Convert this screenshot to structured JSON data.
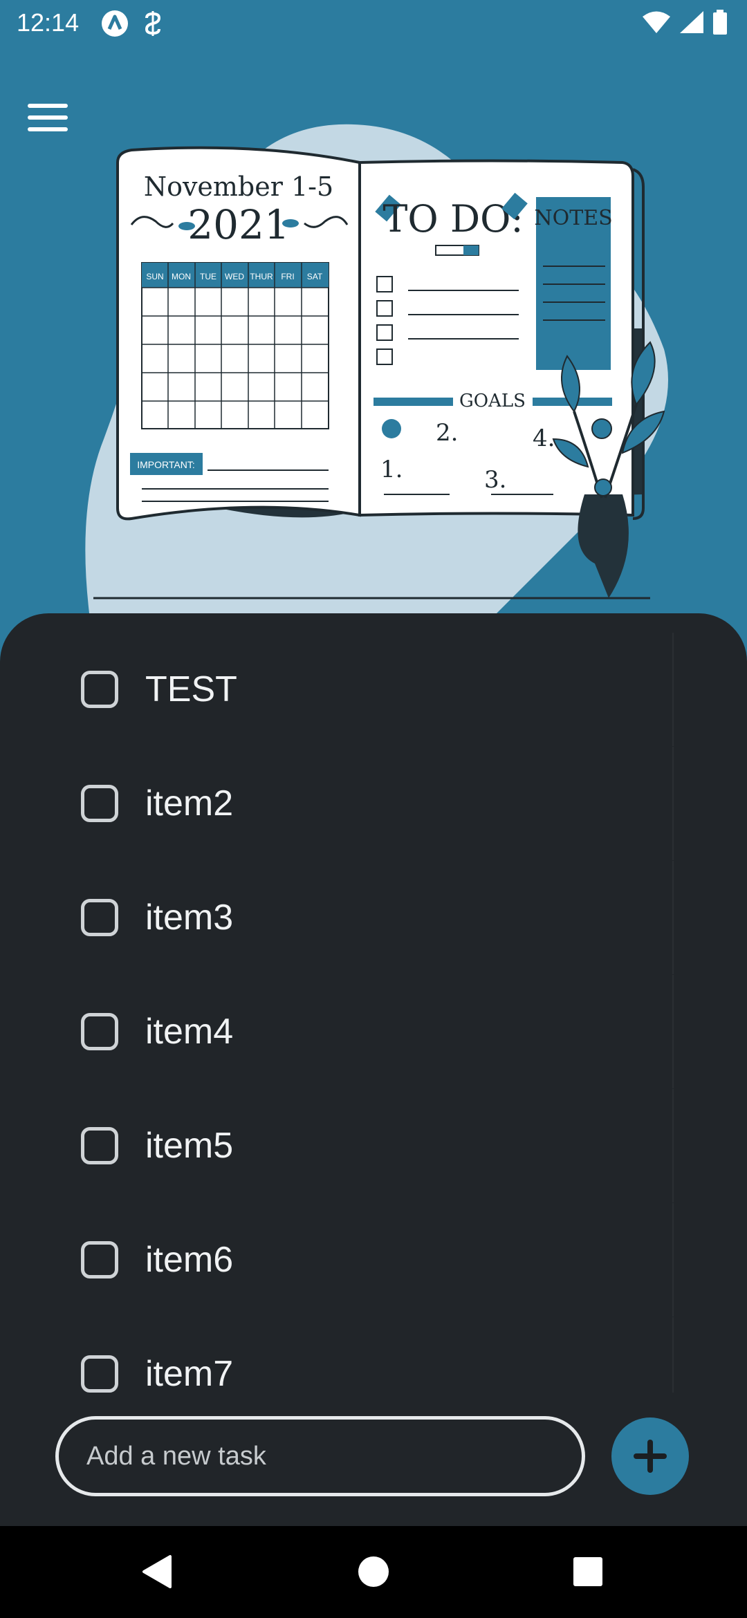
{
  "status_bar": {
    "time": "12:14",
    "icons": [
      "app-indicator-icon",
      "sync-icon",
      "wifi-icon",
      "signal-icon",
      "battery-icon"
    ]
  },
  "header": {
    "menu_icon": "hamburger-menu-icon"
  },
  "illustration": {
    "left_page_title": "November 1-5",
    "left_page_year": "2021",
    "weekdays": [
      "SUN",
      "MON",
      "TUE",
      "WED",
      "THUR",
      "FRI",
      "SAT"
    ],
    "important_label": "IMPORTANT:",
    "todo_title": "TO DO:",
    "notes_title": "NOTES",
    "goals_label": "GOALS",
    "goal_numbers": [
      "1.",
      "2.",
      "3.",
      "4."
    ]
  },
  "tasks": [
    {
      "label": "TEST",
      "checked": false
    },
    {
      "label": "item2",
      "checked": false
    },
    {
      "label": "item3",
      "checked": false
    },
    {
      "label": "item4",
      "checked": false
    },
    {
      "label": "item5",
      "checked": false
    },
    {
      "label": "item6",
      "checked": false
    },
    {
      "label": "item7",
      "checked": false
    }
  ],
  "input": {
    "placeholder": "Add a new task",
    "value": ""
  },
  "add_button": {
    "icon": "plus-icon"
  },
  "colors": {
    "background": "#2c7c9f",
    "sheet": "#212529",
    "accent": "#2c7c9f"
  }
}
